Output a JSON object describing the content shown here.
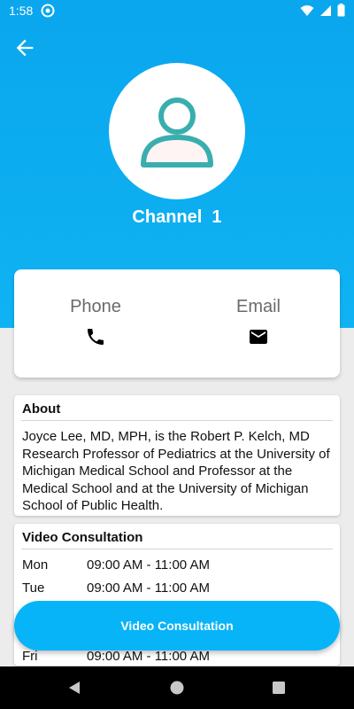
{
  "status_bar": {
    "time": "1:58",
    "icons": [
      "app-notification-icon",
      "wifi-icon",
      "signal-icon",
      "battery-icon"
    ]
  },
  "header": {
    "back_icon": "arrow-left-icon",
    "avatar_icon": "person-icon",
    "title": "Channel  1",
    "accent_color": "#0aa6ee"
  },
  "contact": {
    "phone_label": "Phone",
    "phone_icon": "phone-icon",
    "email_label": "Email",
    "email_icon": "mail-icon"
  },
  "about": {
    "title": "About",
    "text": "Joyce Lee, MD, MPH, is the Robert P. Kelch, MD Research Professor of Pediatrics at the University of Michigan Medical School and Professor at the Medical School and at the University of Michigan School of Public Health."
  },
  "video": {
    "title": "Video Consultation",
    "schedule": [
      {
        "day": "Mon",
        "time": "09:00 AM - 11:00 AM"
      },
      {
        "day": "Tue",
        "time": "09:00 AM - 11:00 AM"
      },
      {
        "day": "Fri",
        "time": "09:00 AM - 11:00 AM"
      }
    ]
  },
  "fab": {
    "label": "Video Consultation",
    "color": "#07b4f7"
  },
  "nav": {
    "icons": [
      "back-triangle-icon",
      "home-circle-icon",
      "recents-square-icon"
    ]
  }
}
